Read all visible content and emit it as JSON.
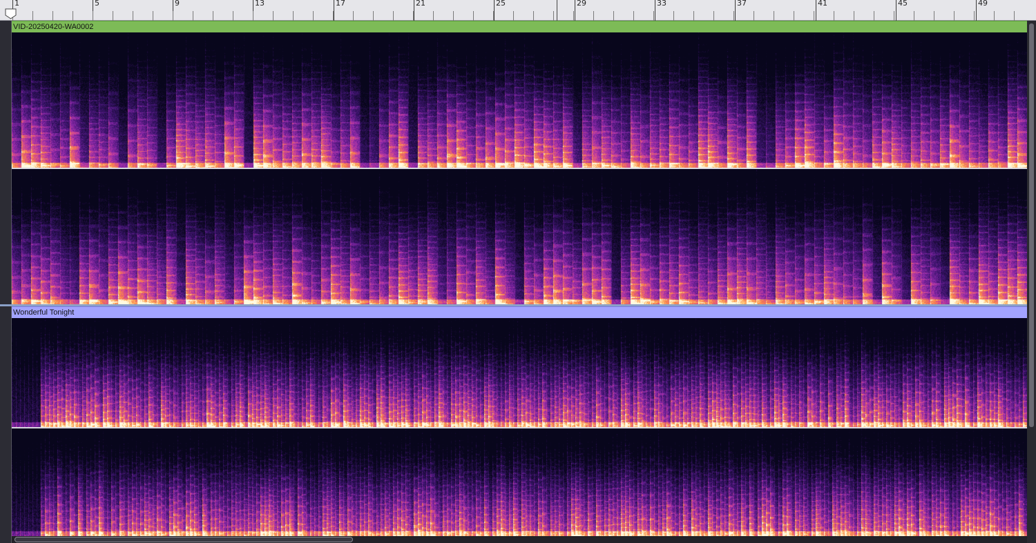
{
  "ruler": {
    "labels": [
      "1",
      "5",
      "9",
      "13",
      "17",
      "21",
      "25",
      "29",
      "33",
      "37",
      "41",
      "45",
      "49"
    ],
    "start": 1,
    "step": 4
  },
  "tracks": [
    {
      "name": "VID-20250420-WA0002",
      "color": "#7dbb57",
      "channels": 2
    },
    {
      "name": "Wonderful Tonight",
      "color": "#a3a4ff",
      "channels": 2
    }
  ],
  "icons": {
    "loop": "loop-marker-icon",
    "handle": "clip-handle-icon"
  },
  "colors": {
    "spectrogram_low": "#0d0a2a",
    "spectrogram_mid": "#7a2fb8",
    "spectrogram_high": "#ff9a3c",
    "spectrogram_peak": "#fff6d0"
  }
}
